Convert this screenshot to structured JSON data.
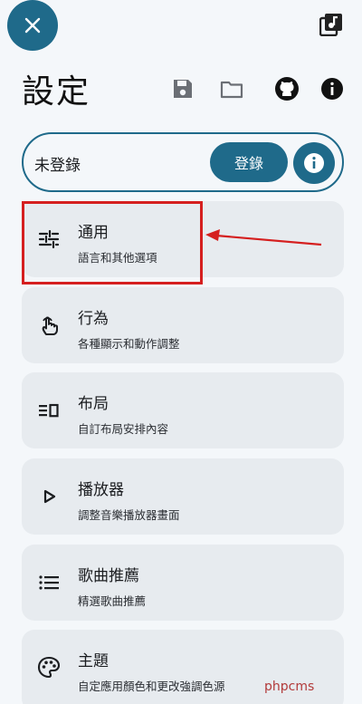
{
  "header": {
    "title": "設定",
    "close_icon": "close-icon",
    "top_right_icon": "music-library-icon",
    "actions": [
      "save-icon",
      "folder-icon",
      "github-icon",
      "info-icon"
    ]
  },
  "account": {
    "status": "未登錄",
    "login_label": "登錄"
  },
  "items": [
    {
      "title": "通用",
      "subtitle": "語言和其他選項",
      "icon": "tune-icon"
    },
    {
      "title": "行為",
      "subtitle": "各種顯示和動作調整",
      "icon": "touch-icon"
    },
    {
      "title": "布局",
      "subtitle": "自訂布局安排內容",
      "icon": "layout-icon"
    },
    {
      "title": "播放器",
      "subtitle": "調整音樂播放器畫面",
      "icon": "play-icon"
    },
    {
      "title": "歌曲推薦",
      "subtitle": "精選歌曲推薦",
      "icon": "list-icon"
    },
    {
      "title": "主題",
      "subtitle": "自定應用顏色和更改強調色源",
      "icon": "palette-icon"
    }
  ],
  "colors": {
    "accent": "#1f6a8a",
    "card": "#e7ebef",
    "annotation": "#d51f1f"
  },
  "watermark": "phpcms"
}
